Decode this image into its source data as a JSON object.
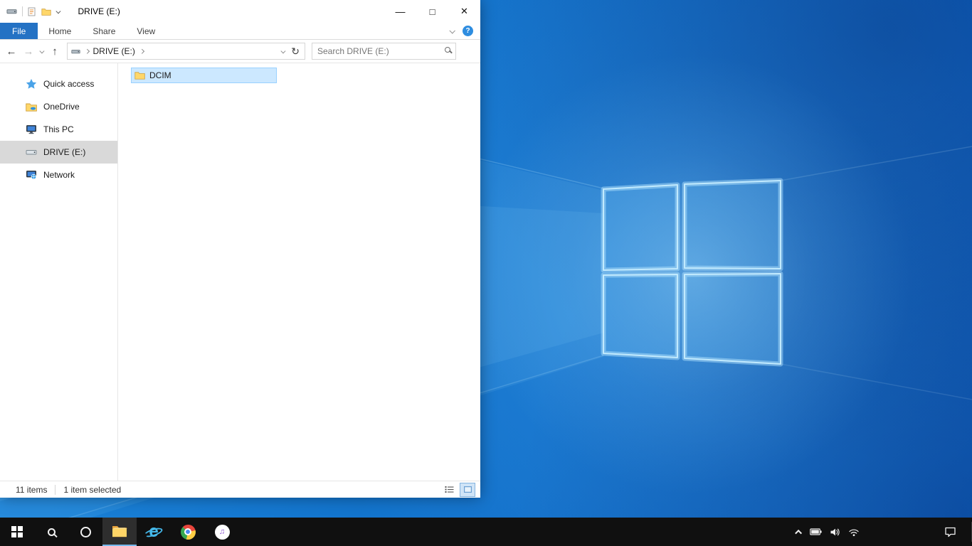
{
  "colors": {
    "accent_blue": "#2472c4",
    "selection_bg": "#cce8ff",
    "selection_border": "#99d1ff",
    "sidebar_selected_bg": "#d9d9d9",
    "taskbar_bg": "#101010",
    "taskbar_active_underline": "#76b9ed",
    "wallpaper_blue": "#0f6ac4"
  },
  "explorer": {
    "title": "DRIVE (E:)",
    "window_controls": {
      "minimize": "—",
      "maximize": "□",
      "close": "✕"
    },
    "ribbon": {
      "tabs": [
        {
          "label": "File",
          "active": true
        },
        {
          "label": "Home",
          "active": false
        },
        {
          "label": "Share",
          "active": false
        },
        {
          "label": "View",
          "active": false
        }
      ]
    },
    "navigation": {
      "back": "←",
      "forward": "→",
      "up": "↑",
      "refresh": "↻",
      "breadcrumb_location": "DRIVE (E:)",
      "search_placeholder": "Search DRIVE (E:)"
    },
    "sidebar": {
      "items": [
        {
          "label": "Quick access",
          "icon": "quick-access-star-icon",
          "selected": false
        },
        {
          "label": "OneDrive",
          "icon": "onedrive-icon",
          "selected": false
        },
        {
          "label": "This PC",
          "icon": "this-pc-icon",
          "selected": false
        },
        {
          "label": "DRIVE (E:)",
          "icon": "drive-icon",
          "selected": true
        },
        {
          "label": "Network",
          "icon": "network-icon",
          "selected": false
        }
      ]
    },
    "files": [
      {
        "name": "DCIM",
        "type": "folder",
        "selected": true
      }
    ],
    "status": {
      "item_count": "11 items",
      "selection": "1 item selected"
    }
  },
  "taskbar": {
    "apps": [
      {
        "name": "start"
      },
      {
        "name": "search"
      },
      {
        "name": "cortana"
      },
      {
        "name": "file-explorer",
        "active": true
      },
      {
        "name": "internet-explorer"
      },
      {
        "name": "chrome"
      },
      {
        "name": "itunes"
      }
    ],
    "tray": [
      "hidden-icons-chevron",
      "battery",
      "volume",
      "network",
      "action-center"
    ]
  }
}
